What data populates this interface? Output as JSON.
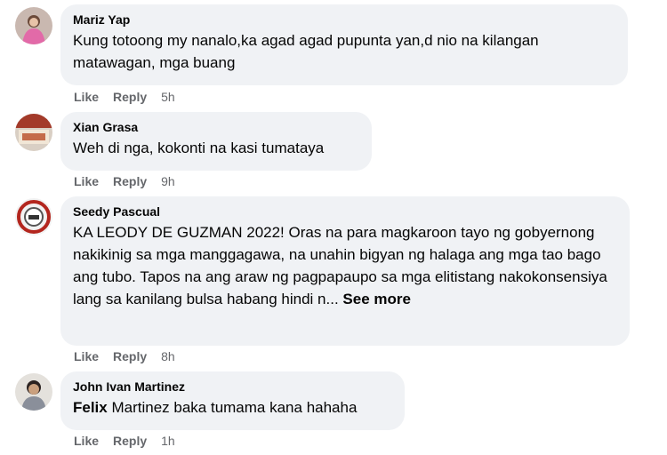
{
  "comments": [
    {
      "author": "Mariz Yap",
      "text": "Kung totoong my nanalo,ka agad agad pupunta yan,d nio na kilangan matawagan, mga buang",
      "like_label": "Like",
      "reply_label": "Reply",
      "time": "5h",
      "avatar_icon": "profile-photo"
    },
    {
      "author": "Xian Grasa",
      "text": "Weh di nga, kokonti na kasi tumataya",
      "like_label": "Like",
      "reply_label": "Reply",
      "time": "9h",
      "avatar_icon": "profile-photo"
    },
    {
      "author": "Seedy Pascual",
      "text": "KA LEODY DE GUZMAN 2022! Oras na para magkaroon tayo ng gobyernong nakikinig sa mga manggagawa, na unahin bigyan ng halaga ang mga tao bago ang tubo. Tapos na ang araw ng pagpapaupo sa mga elitistang nakokonsensiya lang sa kanilang bulsa habang hindi n...",
      "see_more": "See more",
      "like_label": "Like",
      "reply_label": "Reply",
      "time": "8h",
      "avatar_icon": "profile-photo"
    },
    {
      "author": "John Ivan Martinez",
      "mention": "Felix",
      "text": " Martinez baka tumama kana hahaha",
      "like_label": "Like",
      "reply_label": "Reply",
      "time": "1h",
      "avatar_icon": "profile-photo"
    }
  ],
  "colors": {
    "bubble": "#f0f2f5",
    "text": "#050505",
    "secondary": "#65676b"
  }
}
